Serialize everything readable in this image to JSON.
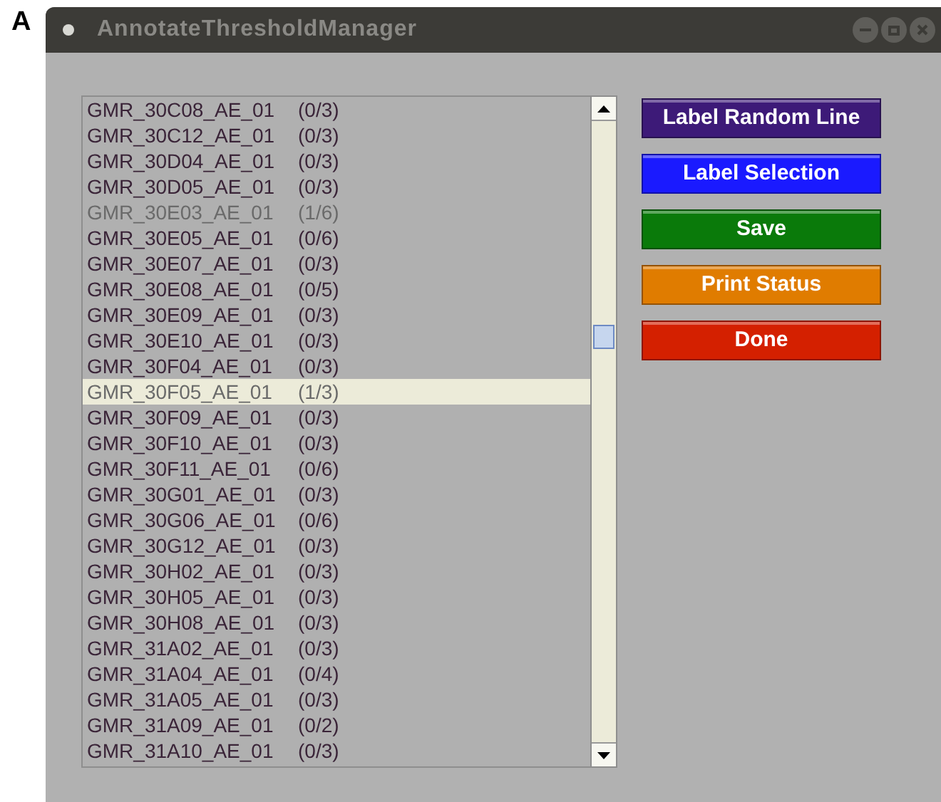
{
  "figure_label": "A",
  "window": {
    "title": "AnnotateThresholdManager"
  },
  "lines": [
    {
      "name": "GMR_30C08_AE_01",
      "count": "(0/3)",
      "dimmed": false,
      "selected": false
    },
    {
      "name": "GMR_30C12_AE_01",
      "count": "(0/3)",
      "dimmed": false,
      "selected": false
    },
    {
      "name": "GMR_30D04_AE_01",
      "count": "(0/3)",
      "dimmed": false,
      "selected": false
    },
    {
      "name": "GMR_30D05_AE_01",
      "count": "(0/3)",
      "dimmed": false,
      "selected": false
    },
    {
      "name": "GMR_30E03_AE_01",
      "count": "(1/6)",
      "dimmed": true,
      "selected": false
    },
    {
      "name": "GMR_30E05_AE_01",
      "count": "(0/6)",
      "dimmed": false,
      "selected": false
    },
    {
      "name": "GMR_30E07_AE_01",
      "count": "(0/3)",
      "dimmed": false,
      "selected": false
    },
    {
      "name": "GMR_30E08_AE_01",
      "count": "(0/5)",
      "dimmed": false,
      "selected": false
    },
    {
      "name": "GMR_30E09_AE_01",
      "count": "(0/3)",
      "dimmed": false,
      "selected": false
    },
    {
      "name": "GMR_30E10_AE_01",
      "count": "(0/3)",
      "dimmed": false,
      "selected": false
    },
    {
      "name": "GMR_30F04_AE_01",
      "count": "(0/3)",
      "dimmed": false,
      "selected": false
    },
    {
      "name": "GMR_30F05_AE_01",
      "count": "(1/3)",
      "dimmed": true,
      "selected": true
    },
    {
      "name": "GMR_30F09_AE_01",
      "count": "(0/3)",
      "dimmed": false,
      "selected": false
    },
    {
      "name": "GMR_30F10_AE_01",
      "count": "(0/3)",
      "dimmed": false,
      "selected": false
    },
    {
      "name": "GMR_30F11_AE_01",
      "count": "(0/6)",
      "dimmed": false,
      "selected": false
    },
    {
      "name": "GMR_30G01_AE_01",
      "count": "(0/3)",
      "dimmed": false,
      "selected": false
    },
    {
      "name": "GMR_30G06_AE_01",
      "count": "(0/6)",
      "dimmed": false,
      "selected": false
    },
    {
      "name": "GMR_30G12_AE_01",
      "count": "(0/3)",
      "dimmed": false,
      "selected": false
    },
    {
      "name": "GMR_30H02_AE_01",
      "count": "(0/3)",
      "dimmed": false,
      "selected": false
    },
    {
      "name": "GMR_30H05_AE_01",
      "count": "(0/3)",
      "dimmed": false,
      "selected": false
    },
    {
      "name": "GMR_30H08_AE_01",
      "count": "(0/3)",
      "dimmed": false,
      "selected": false
    },
    {
      "name": "GMR_31A02_AE_01",
      "count": "(0/3)",
      "dimmed": false,
      "selected": false
    },
    {
      "name": "GMR_31A04_AE_01",
      "count": "(0/4)",
      "dimmed": false,
      "selected": false
    },
    {
      "name": "GMR_31A05_AE_01",
      "count": "(0/3)",
      "dimmed": false,
      "selected": false
    },
    {
      "name": "GMR_31A09_AE_01",
      "count": "(0/2)",
      "dimmed": false,
      "selected": false
    },
    {
      "name": "GMR_31A10_AE_01",
      "count": "(0/3)",
      "dimmed": false,
      "selected": false
    }
  ],
  "buttons": [
    {
      "label": "Label Random Line",
      "color": "#3d1a78"
    },
    {
      "label": "Label Selection",
      "color": "#1a1aff"
    },
    {
      "label": "Save",
      "color": "#0a7a0a"
    },
    {
      "label": "Print Status",
      "color": "#e07c00"
    },
    {
      "label": "Done",
      "color": "#d42000"
    }
  ]
}
